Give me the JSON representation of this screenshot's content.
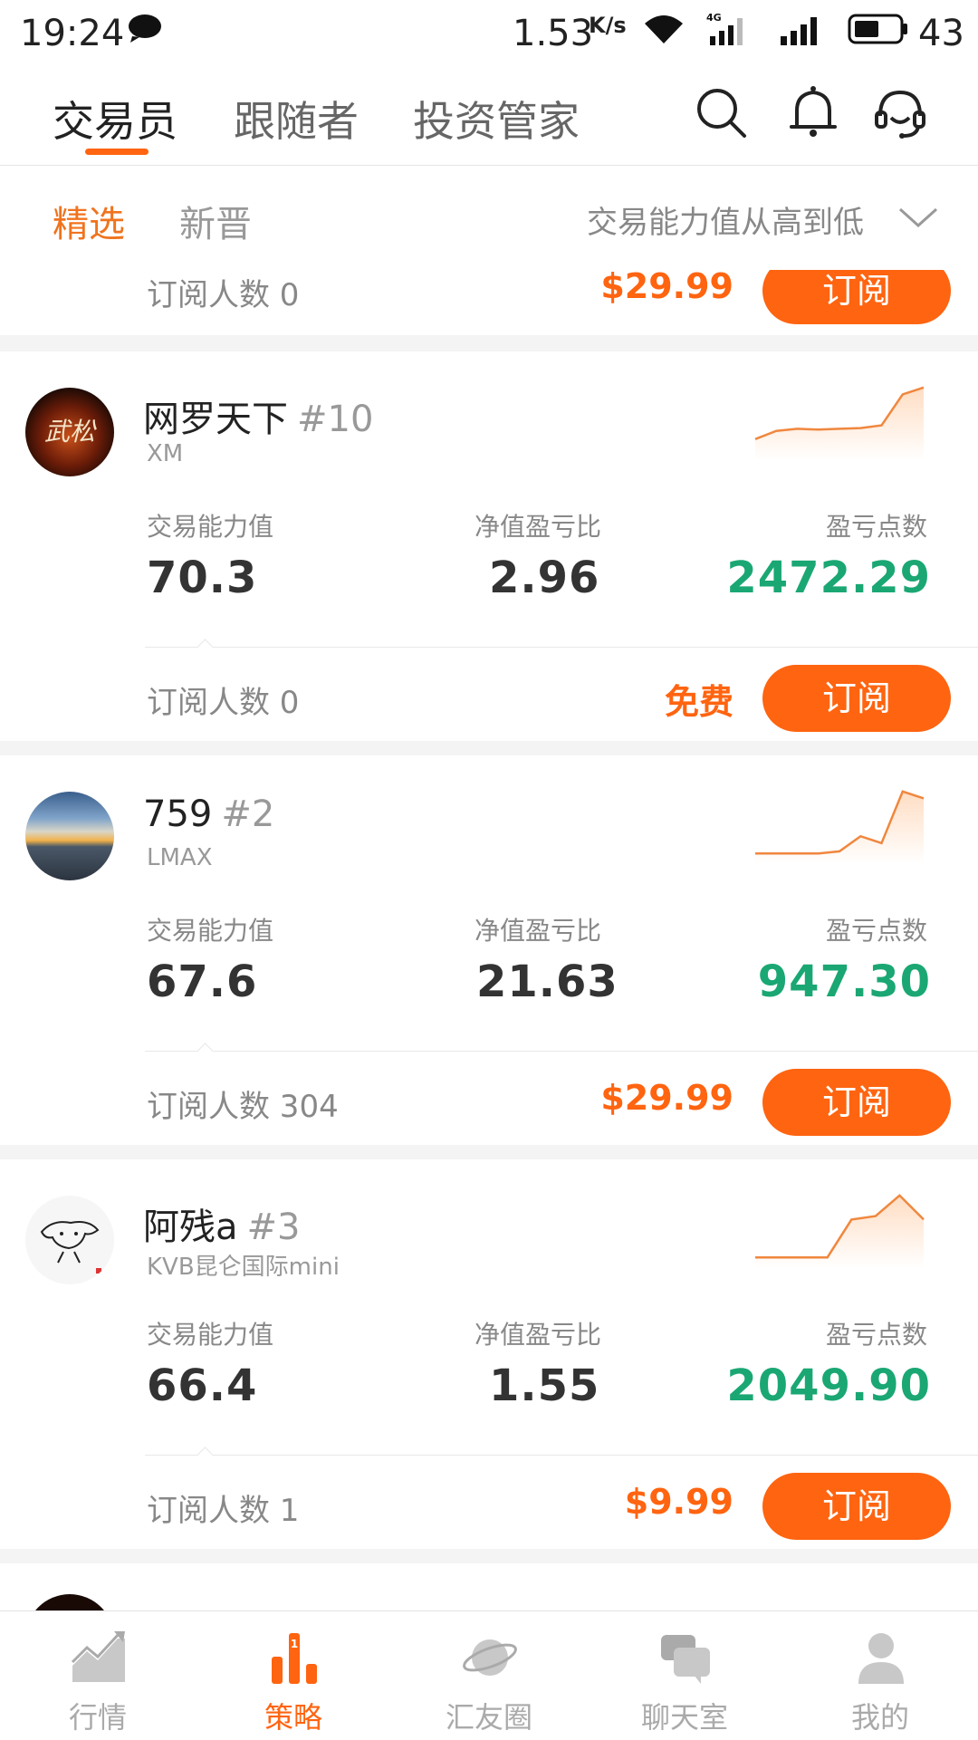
{
  "status": {
    "time": "19:24",
    "speed": "1.53",
    "speed_unit": "K/s",
    "battery": "43"
  },
  "top_tabs": [
    "交易员",
    "跟随者",
    "投资管家"
  ],
  "sub_tabs": [
    "精选",
    "新晋"
  ],
  "sort_label": "交易能力值从高到低",
  "labels": {
    "ability": "交易能力值",
    "ratio": "净值盈亏比",
    "points": "盈亏点数",
    "subscribe": "订阅"
  },
  "partial_top": {
    "subs": "订阅人数 0",
    "price": "$29.99"
  },
  "traders": [
    {
      "name": "网罗天下",
      "rank": "#10",
      "broker": "XM",
      "ability": "70.3",
      "ratio": "2.96",
      "points": "2472.29",
      "subs": "订阅人数 0",
      "price": "免费",
      "spark": [
        0.2,
        0.32,
        0.35,
        0.34,
        0.35,
        0.36,
        0.4,
        0.85,
        0.95
      ]
    },
    {
      "name": "759",
      "rank": "#2",
      "broker": "LMAX",
      "ability": "67.6",
      "ratio": "21.63",
      "points": "947.30",
      "subs": "订阅人数 304",
      "price": "$29.99",
      "spark": [
        0.05,
        0.05,
        0.05,
        0.05,
        0.08,
        0.3,
        0.2,
        0.95,
        0.85
      ]
    },
    {
      "name": "阿残a",
      "rank": "#3",
      "broker": "KVB昆仑国际mini",
      "ability": "66.4",
      "ratio": "1.55",
      "points": "2049.90",
      "subs": "订阅人数 1",
      "price": "$9.99",
      "spark": [
        0.05,
        0.05,
        0.05,
        0.05,
        0.6,
        0.65,
        0.95,
        0.6
      ]
    }
  ],
  "bottom_nav": [
    "行情",
    "策略",
    "汇友圈",
    "聊天室",
    "我的"
  ],
  "colors": {
    "accent": "#ff6410",
    "green": "#1aa774"
  }
}
